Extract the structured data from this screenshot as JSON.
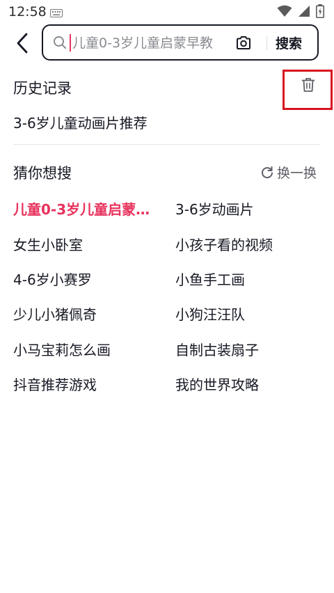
{
  "status_bar": {
    "time": "12:58"
  },
  "search": {
    "placeholder": "儿童0-3岁儿童启蒙早教",
    "button_label": "搜索"
  },
  "history": {
    "title": "历史记录",
    "items": [
      "3-6岁儿童动画片推荐"
    ]
  },
  "suggestions": {
    "title": "猜你想搜",
    "refresh_label": "换一换",
    "items": [
      "儿童0-3岁儿童启蒙…",
      "3-6岁动画片",
      "女生小卧室",
      "小孩子看的视频",
      "4-6岁小赛罗",
      "小鱼手工画",
      "少儿小猪佩奇",
      "小狗汪汪队",
      "小马宝莉怎么画",
      "自制古装扇子",
      "抖音推荐游戏",
      "我的世界攻略"
    ]
  },
  "colors": {
    "accent": "#e8325d",
    "highlight_box": "#d9131f",
    "text": "#161823"
  }
}
